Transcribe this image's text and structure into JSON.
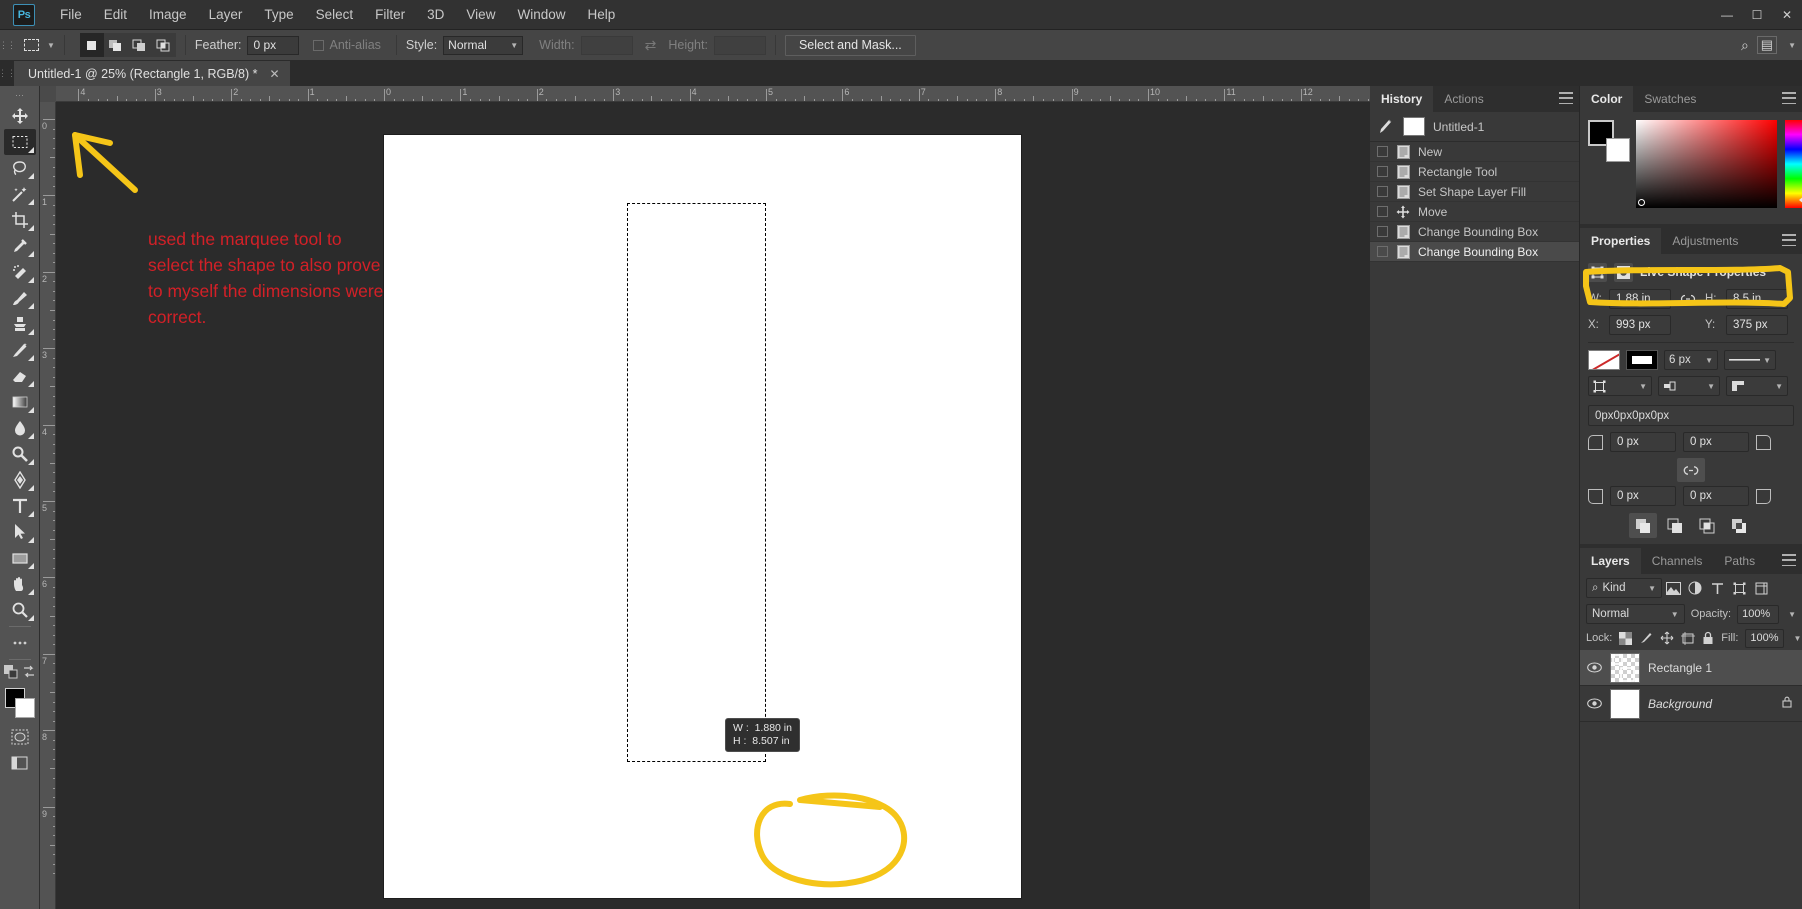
{
  "app": {
    "name": "Adobe Photoshop",
    "logo_text": "Ps"
  },
  "menubar": {
    "items": [
      "File",
      "Edit",
      "Image",
      "Layer",
      "Type",
      "Select",
      "Filter",
      "3D",
      "View",
      "Window",
      "Help"
    ]
  },
  "window_controls": {
    "minimize": "—",
    "maximize": "☐",
    "close": "✕"
  },
  "options_bar": {
    "tool_icon": "rectangular-marquee",
    "feather_label": "Feather:",
    "feather_value": "0 px",
    "antialias_label": "Anti-alias",
    "antialias_checked": false,
    "style_label": "Style:",
    "style_value": "Normal",
    "width_label": "Width:",
    "width_value": "",
    "height_label": "Height:",
    "height_value": "",
    "swap_icon": "swap-arrows-icon",
    "select_and_mask": "Select and Mask...",
    "search_icon": "search-icon",
    "workspace_icon": "workspace-switcher-icon"
  },
  "document_tab": {
    "title": "Untitled-1 @ 25% (Rectangle 1, RGB/8) *",
    "close": "✕"
  },
  "toolbar": {
    "tools": [
      {
        "name": "move-tool",
        "glyph": "move",
        "active": false,
        "has_flyout": false
      },
      {
        "name": "rectangular-marquee-tool",
        "glyph": "marquee",
        "active": true,
        "has_flyout": true
      },
      {
        "name": "lasso-tool",
        "glyph": "lasso",
        "active": false,
        "has_flyout": true
      },
      {
        "name": "object-selection-tool",
        "glyph": "wand",
        "active": false,
        "has_flyout": true
      },
      {
        "name": "crop-tool",
        "glyph": "crop",
        "active": false,
        "has_flyout": true
      },
      {
        "name": "eyedropper-tool",
        "glyph": "eyedropper",
        "active": false,
        "has_flyout": true
      },
      {
        "name": "spot-healing-brush-tool",
        "glyph": "healing",
        "active": false,
        "has_flyout": true
      },
      {
        "name": "brush-tool",
        "glyph": "brush",
        "active": false,
        "has_flyout": true
      },
      {
        "name": "clone-stamp-tool",
        "glyph": "stamp",
        "active": false,
        "has_flyout": true
      },
      {
        "name": "history-brush-tool",
        "glyph": "historybrush",
        "active": false,
        "has_flyout": true
      },
      {
        "name": "eraser-tool",
        "glyph": "eraser",
        "active": false,
        "has_flyout": true
      },
      {
        "name": "gradient-tool",
        "glyph": "gradient",
        "active": false,
        "has_flyout": true
      },
      {
        "name": "blur-tool",
        "glyph": "blur",
        "active": false,
        "has_flyout": true
      },
      {
        "name": "dodge-tool",
        "glyph": "dodge",
        "active": false,
        "has_flyout": true
      },
      {
        "name": "pen-tool",
        "glyph": "pen",
        "active": false,
        "has_flyout": true
      },
      {
        "name": "type-tool",
        "glyph": "type",
        "active": false,
        "has_flyout": true
      },
      {
        "name": "path-selection-tool",
        "glyph": "pathselect",
        "active": false,
        "has_flyout": true
      },
      {
        "name": "rectangle-tool",
        "glyph": "rectangle",
        "active": false,
        "has_flyout": true
      },
      {
        "name": "hand-tool",
        "glyph": "hand",
        "active": false,
        "has_flyout": true
      },
      {
        "name": "zoom-tool",
        "glyph": "zoom",
        "active": false,
        "has_flyout": true
      },
      {
        "name": "edit-toolbar-button",
        "glyph": "ellipsis",
        "active": false,
        "has_flyout": false
      }
    ],
    "foreground_color": "#000000",
    "background_color": "#ffffff",
    "quickmask_icon": "quick-mask-icon",
    "screenmode_icon": "screen-mode-icon"
  },
  "canvas": {
    "zoom": "25%",
    "ruler_unit": "inches",
    "ruler_h_labels": [
      "4",
      "3",
      "2",
      "1",
      "0",
      "1",
      "2",
      "3",
      "4",
      "5",
      "6",
      "7",
      "8",
      "9",
      "10",
      "11",
      "12"
    ],
    "ruler_v_labels": [
      "0",
      "1",
      "2",
      "3",
      "4",
      "5",
      "6",
      "7",
      "8",
      "9"
    ],
    "selection_tooltip": {
      "w_label": "W :",
      "w_value": "1.880 in",
      "h_label": "H :",
      "h_value": "8.507 in"
    }
  },
  "annotations": {
    "text": "used the marquee tool to select the shape to also prove to myself the dimensions were correct.",
    "text_color": "#d32027",
    "highlight_color": "#f5c518",
    "arrow_name": "yellow-arrow-annotation",
    "circle_name": "yellow-circle-annotation",
    "box_name": "yellow-box-annotation"
  },
  "history_panel": {
    "tabs": [
      {
        "label": "History",
        "active": true
      },
      {
        "label": "Actions",
        "active": false
      }
    ],
    "snapshot": "Untitled-1",
    "states": [
      {
        "label": "New",
        "icon": "document-icon",
        "selected": false
      },
      {
        "label": "Rectangle Tool",
        "icon": "document-icon",
        "selected": false
      },
      {
        "label": "Set Shape Layer Fill",
        "icon": "document-icon",
        "selected": false
      },
      {
        "label": "Move",
        "icon": "move-icon",
        "selected": false
      },
      {
        "label": "Change Bounding Box",
        "icon": "document-icon",
        "selected": false
      },
      {
        "label": "Change Bounding Box",
        "icon": "document-icon",
        "selected": true
      }
    ]
  },
  "color_panel": {
    "tabs": [
      {
        "label": "Color",
        "active": true
      },
      {
        "label": "Swatches",
        "active": false
      }
    ],
    "foreground": "#000000",
    "background": "#ffffff"
  },
  "properties_panel": {
    "tabs": [
      {
        "label": "Properties",
        "active": true
      },
      {
        "label": "Adjustments",
        "active": false
      }
    ],
    "section_title": "Live Shape Properties",
    "w_label": "W:",
    "w_value": "1.88 in",
    "link_label": "∞",
    "h_label": "H:",
    "h_value": "8.5 in",
    "x_label": "X:",
    "x_value": "993 px",
    "y_label": "Y:",
    "y_value": "375 px",
    "stroke_width": "6 px",
    "radius_combined": "0px0px0px0px",
    "corner_tl": "0 px",
    "corner_tr": "0 px",
    "corner_bl": "0 px",
    "corner_br": "0 px",
    "link_corners_icon": "chain-link-icon",
    "path_ops": [
      "combine-shapes",
      "subtract-front-shape",
      "intersect-shape-areas",
      "exclude-overlapping-shapes"
    ]
  },
  "layers_panel": {
    "tabs": [
      {
        "label": "Layers",
        "active": true
      },
      {
        "label": "Channels",
        "active": false
      },
      {
        "label": "Paths",
        "active": false
      }
    ],
    "filter_label": "Kind",
    "filter_icons": [
      "pixel-layer-filter-icon",
      "adjustment-layer-filter-icon",
      "type-layer-filter-icon",
      "shape-layer-filter-icon",
      "smart-object-filter-icon"
    ],
    "blend_mode": "Normal",
    "opacity_label": "Opacity:",
    "opacity_value": "100%",
    "lock_label": "Lock:",
    "lock_icons": [
      "lock-transparency-icon",
      "lock-image-icon",
      "lock-position-icon",
      "lock-artboard-icon",
      "lock-all-icon"
    ],
    "fill_label": "Fill:",
    "fill_value": "100%",
    "layers": [
      {
        "name": "Rectangle 1",
        "visible": true,
        "selected": true,
        "locked": false,
        "thumb": "shape"
      },
      {
        "name": "Background",
        "visible": true,
        "selected": false,
        "locked": true,
        "thumb": "white"
      }
    ]
  }
}
